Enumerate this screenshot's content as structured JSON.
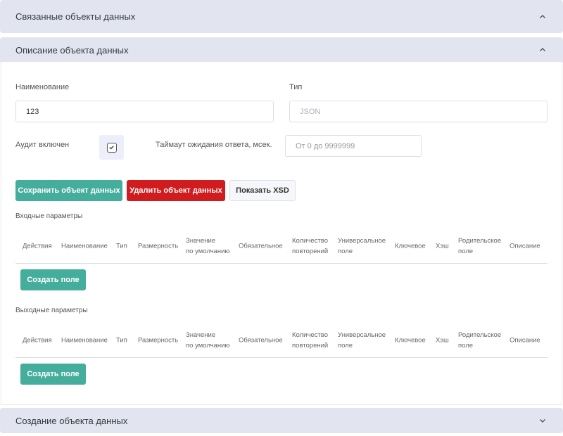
{
  "accordions": {
    "related": "Связанные объекты данных",
    "description": "Описание объекта данных",
    "create": "Создание объекта данных"
  },
  "form": {
    "name_label": "Наименование",
    "name_value": "123",
    "type_label": "Тип",
    "type_value": "JSON",
    "audit_label": "Аудит включен",
    "audit_checked": true,
    "timeout_label": "Таймаут ожидания ответа, мсек.",
    "timeout_placeholder": "От 0 до 9999999"
  },
  "buttons": {
    "save": "Сохранить объект данных",
    "delete": "Удалить объект данных",
    "show_xsd": "Показать XSD",
    "create_field": "Создать поле"
  },
  "input_params": {
    "title": "Входные параметры"
  },
  "output_params": {
    "title": "Выходные параметры"
  },
  "columns": {
    "actions": "Действия",
    "name": "Наименование",
    "type": "Тип",
    "dimension": "Размерность",
    "default_1": "Значение",
    "default_2": "по умолчанию",
    "required": "Обязательное",
    "count_1": "Количество",
    "count_2": "повторений",
    "universal_1": "Универсальное",
    "universal_2": "поле",
    "key": "Ключевое",
    "hash": "Хэш",
    "parent_1": "Родительское",
    "parent_2": "поле",
    "description": "Описание"
  },
  "colors": {
    "accent": "#45ad9c",
    "danger": "#d01c1f",
    "header_bg": "#e2e5ef"
  },
  "icons": {
    "collapse": "chevron-up-icon",
    "expand": "chevron-down-icon",
    "check": "check-icon"
  }
}
